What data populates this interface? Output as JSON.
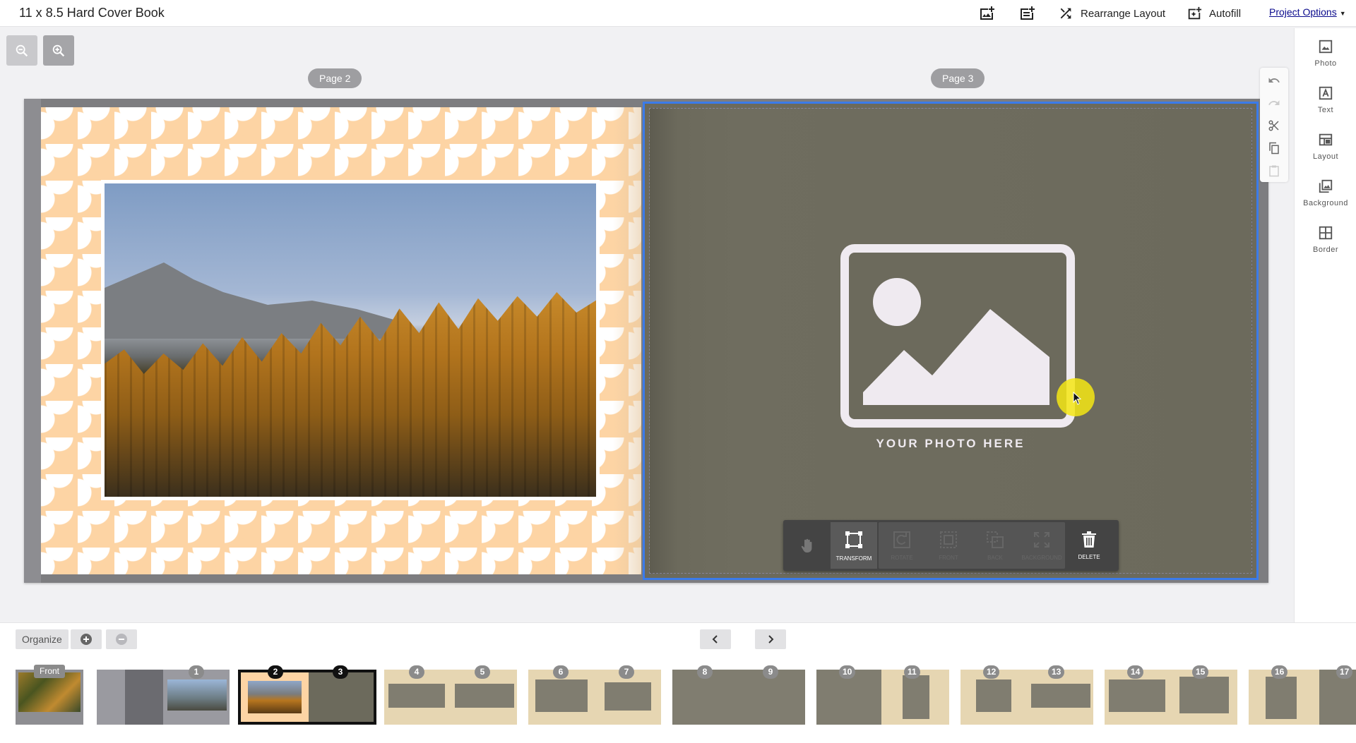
{
  "header": {
    "title": "11 x 8.5 Hard Cover Book",
    "add_photo_page_icon": "add-photo-page-icon",
    "add_text_page_icon": "add-page-icon",
    "rearrange_label": "Rearrange Layout",
    "autofill_label": "Autofill",
    "project_options_label": "Project Options"
  },
  "spread": {
    "left_page_label": "Page 2",
    "right_page_label": "Page 3",
    "placeholder_caption": "YOUR PHOTO HERE"
  },
  "object_toolbar": {
    "transform": "TRANSFORM",
    "rotate": "ROTATE",
    "front": "FRONT",
    "back": "BACK",
    "background": "BACKGROUND",
    "delete": "DELETE"
  },
  "side_panel": {
    "photo": "Photo",
    "text": "Text",
    "layout": "Layout",
    "background": "Background",
    "border": "Border"
  },
  "bottom": {
    "organize_label": "Organize",
    "front_label": "Front",
    "thumb_numbers": [
      "1",
      "2",
      "3",
      "4",
      "5",
      "6",
      "7",
      "8",
      "9",
      "10",
      "11",
      "12",
      "13",
      "14",
      "15",
      "16",
      "17"
    ]
  },
  "colors": {
    "selection": "#3b7bea",
    "placeholder_bg": "#6c6a5c",
    "pattern_peach": "#fdd4a4",
    "cursor_highlight": "#f5e614"
  }
}
